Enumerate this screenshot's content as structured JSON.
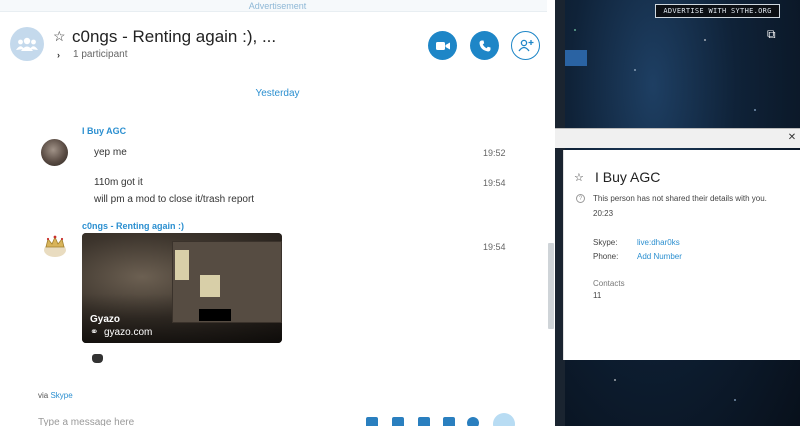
{
  "ad_label": "Advertisement",
  "chat": {
    "title": "c0ngs - Renting again :), ...",
    "participants": "1 participant",
    "day_separator": "Yesterday",
    "messages": [
      {
        "sender": "I Buy AGC",
        "text": "yep me",
        "time": "19:52"
      },
      {
        "sender": "I Buy AGC",
        "text": "110m got it",
        "time": "19:54"
      },
      {
        "sender": "I Buy AGC",
        "text": "will pm a mod to close it/trash report",
        "time": ""
      },
      {
        "sender": "c0ngs - Renting again :)",
        "text": "",
        "time": "19:54"
      }
    ],
    "preview": {
      "title": "Gyazo",
      "domain": "gyazo.com"
    },
    "via_prefix": "via",
    "via_link": "Skype",
    "composer_placeholder": "Type a message here"
  },
  "background_window": {
    "banner": "ADVERTISE WITH SYTHE.ORG"
  },
  "profile": {
    "name": "I Buy AGC",
    "info": "This person has not shared their details with you.",
    "time": "20:23",
    "skype_label": "Skype:",
    "skype_value": "live:dhar0ks",
    "phone_label": "Phone:",
    "phone_value": "Add Number",
    "contacts_label": "Contacts",
    "contacts_value": "11"
  },
  "colors": {
    "accent": "#1e86c7",
    "link": "#2b8fd0"
  }
}
